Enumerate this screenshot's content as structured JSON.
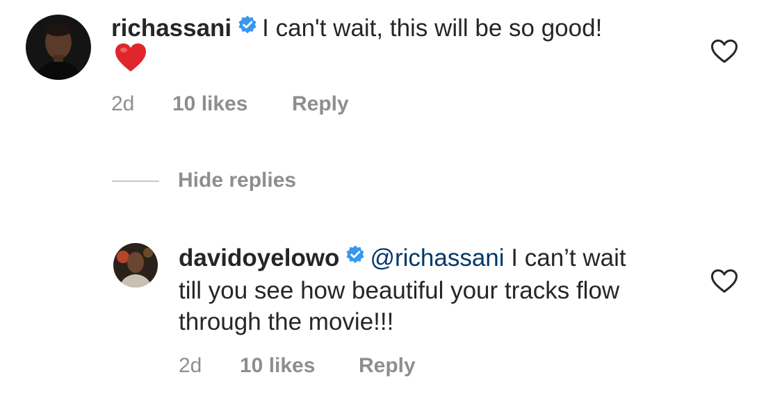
{
  "comments": [
    {
      "username": "richassani",
      "text": "I can't wait, this will be so good!",
      "emoji": "❤️",
      "time": "2d",
      "likes": "10 likes",
      "reply_label": "Reply",
      "verified": true
    },
    {
      "username": "davidoyelowo",
      "mention": "@richassani",
      "text": "I can’t wait till you see how beautiful your tracks flow through the movie!!!",
      "time": "2d",
      "likes": "10 likes",
      "reply_label": "Reply",
      "verified": true
    }
  ],
  "hide_replies_label": "Hide replies",
  "icons": {
    "verified": "verified-badge-icon",
    "like": "heart-outline-icon"
  },
  "colors": {
    "text": "#262626",
    "secondary": "#8e8e8e",
    "mention": "#00376b",
    "verified": "#3897f0",
    "heart_emoji": "#e0262b"
  }
}
